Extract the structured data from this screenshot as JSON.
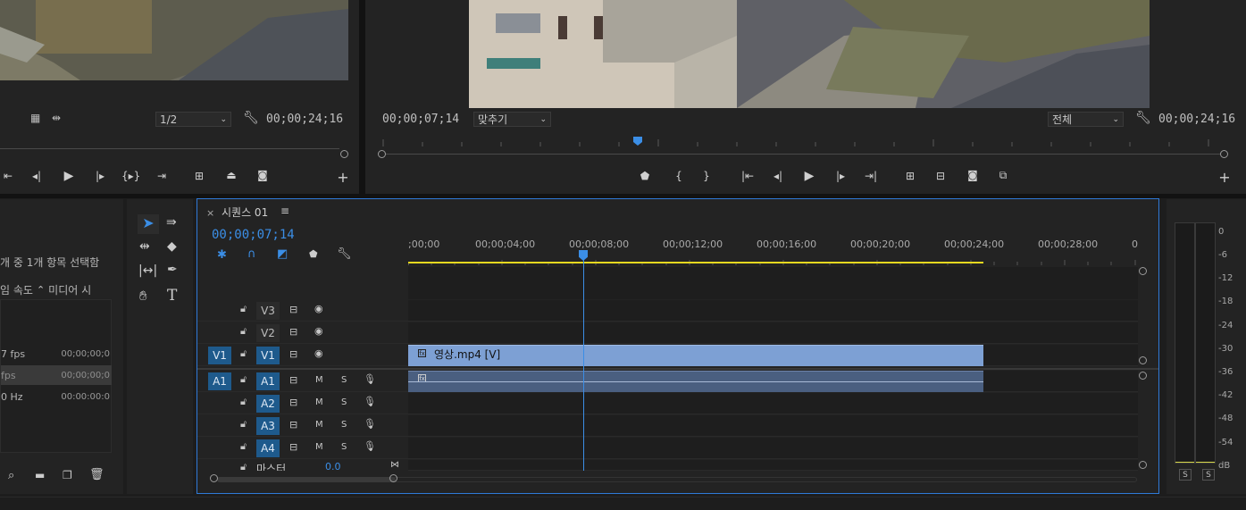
{
  "source_monitor": {
    "zoom": "1/2",
    "duration": "00;00;24;16"
  },
  "program_monitor": {
    "current_time": "00;00;07;14",
    "fit": "맞추기",
    "quality": "전체",
    "duration": "00;00;24;16"
  },
  "project_panel": {
    "selection_status": "개 중 1개 항목 선택함",
    "col_speed": "임 속도",
    "col_media": "미디어 시",
    "rows": [
      {
        "speed": "7 fps",
        "time": "00;00;00;0"
      },
      {
        "speed": "fps",
        "time": "00;00;00;0"
      },
      {
        "speed": "0 Hz",
        "time": "00:00:00:0"
      }
    ]
  },
  "timeline": {
    "tab_title": "시퀀스 01",
    "current_time": "00;00;07;14",
    "ruler_labels": [
      ";00;00",
      "00;00;04;00",
      "00;00;08;00",
      "00;00;12;00",
      "00;00;16;00",
      "00;00;20;00",
      "00;00;24;00",
      "00;00;28;00",
      "0"
    ],
    "video_tracks": [
      {
        "name": "V3",
        "src": ""
      },
      {
        "name": "V2",
        "src": ""
      },
      {
        "name": "V1",
        "src": "V1"
      }
    ],
    "audio_tracks": [
      {
        "name": "A1",
        "src": "A1"
      },
      {
        "name": "A2",
        "src": ""
      },
      {
        "name": "A3",
        "src": ""
      },
      {
        "name": "A4",
        "src": ""
      }
    ],
    "mute_label": "M",
    "solo_label": "S",
    "master_label": "마스터",
    "master_value": "0.0",
    "video_clip_label": "영상.mp4 [V]"
  },
  "audio_meter": {
    "scale": [
      "0",
      "-6",
      "-12",
      "-18",
      "-24",
      "-30",
      "-36",
      "-42",
      "-48",
      "-54",
      "dB"
    ],
    "solo_left": "S",
    "solo_right": "S"
  },
  "icons": [
    "wrench-icon",
    "play-icon",
    "step-back-icon",
    "step-forward-icon",
    "camera-icon",
    "plus-icon",
    "selection-tool-icon",
    "razor-icon",
    "pen-icon",
    "hand-icon",
    "type-icon",
    "lock-icon",
    "eye-icon",
    "mic-icon",
    "search-icon",
    "folder-icon",
    "trash-icon"
  ]
}
